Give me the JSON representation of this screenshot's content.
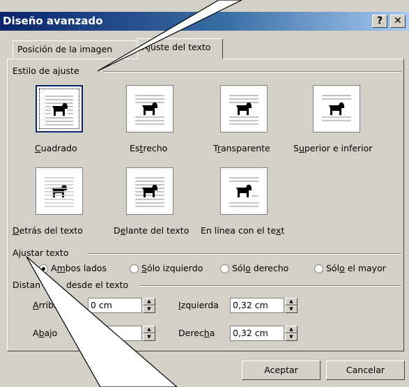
{
  "window": {
    "title": "Diseño avanzado",
    "help": "?",
    "close": "✕"
  },
  "tabs": [
    {
      "label": "Posición de la imagen"
    },
    {
      "label": "Ajuste del texto"
    }
  ],
  "wrap_style": {
    "group_label": "Estilo de ajuste",
    "options": [
      {
        "label_pre": "",
        "key": "C",
        "label_post": "uadrado",
        "selected": true
      },
      {
        "label_pre": "Es",
        "key": "t",
        "label_post": "recho"
      },
      {
        "label_pre": "T",
        "key": "r",
        "label_post": "ansparente"
      },
      {
        "label_pre": "S",
        "key": "u",
        "label_post": "perior e inferior"
      },
      {
        "label_pre": "",
        "key": "D",
        "label_post": "etrás del texto"
      },
      {
        "label_pre": "D",
        "key": "e",
        "label_post": "lante del texto"
      },
      {
        "label_pre": "En línea con el te",
        "key": "x",
        "label_post": "t"
      }
    ]
  },
  "wrap_text": {
    "group_label_pre": "A",
    "group_label_key": "j",
    "group_label_post": "ustar texto",
    "options": [
      {
        "pre": "A",
        "key": "m",
        "post": "bos lados",
        "selected": true
      },
      {
        "pre": "",
        "key": "S",
        "post": "ólo izquierdo"
      },
      {
        "pre": "Sól",
        "key": "o",
        "post": " derecho"
      },
      {
        "pre": "Sól",
        "key": "o",
        "post": " el mayor"
      }
    ]
  },
  "distance": {
    "group_label_a": "Distan",
    "group_label_b": "desde el texto",
    "top": {
      "pre": "",
      "key": "A",
      "post": "rriba",
      "value": "0 cm"
    },
    "bottom": {
      "pre": "A",
      "key": "b",
      "post": "ajo",
      "value": ""
    },
    "left": {
      "pre": "",
      "key": "I",
      "post": "zquierda",
      "value": "0,32 cm"
    },
    "right": {
      "pre": "Derec",
      "key": "h",
      "post": "a",
      "value": "0,32 cm"
    }
  },
  "buttons": {
    "ok": "Aceptar",
    "cancel": "Cancelar"
  },
  "icons": {
    "dog": "dog-icon",
    "spin_up": "▲",
    "spin_down": "▼"
  }
}
